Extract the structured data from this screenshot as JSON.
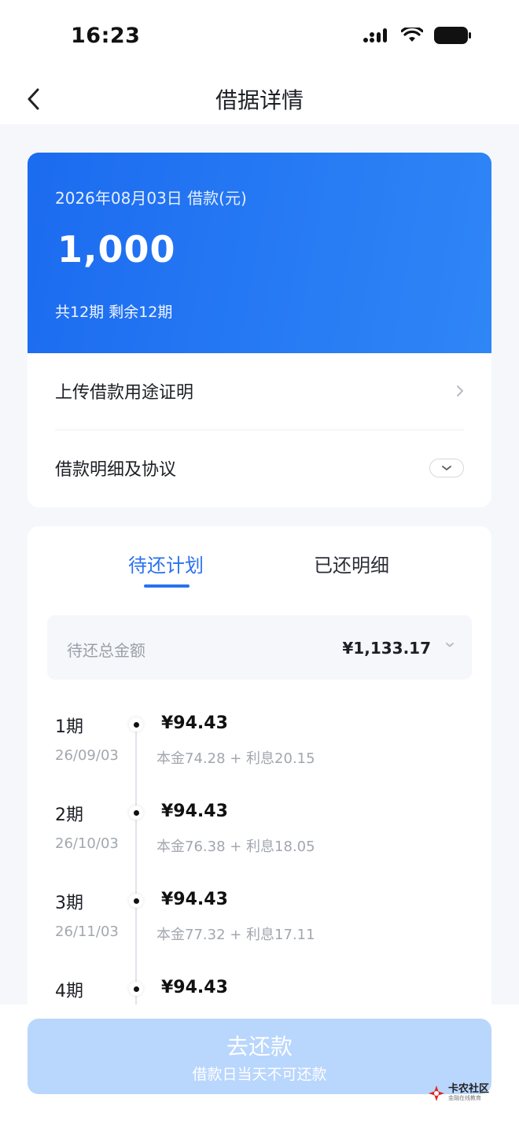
{
  "status_bar": {
    "time": "16:23"
  },
  "nav": {
    "title": "借据详情"
  },
  "loan": {
    "date_label": "2026年08月03日 借款(元)",
    "amount": "1,000",
    "terms": "共12期  剩余12期",
    "accent_color": "#1c6bf0"
  },
  "rows": {
    "upload_proof": "上传借款用途证明",
    "details_agreement": "借款明细及协议"
  },
  "tabs": {
    "pending_plan": "待还计划",
    "paid_details": "已还明细"
  },
  "total": {
    "label": "待还总金额",
    "amount": "¥1,133.17"
  },
  "installments": [
    {
      "period": "1期",
      "date": "26/09/03",
      "amount": "¥94.43",
      "breakdown": "本金74.28 + 利息20.15"
    },
    {
      "period": "2期",
      "date": "26/10/03",
      "amount": "¥94.43",
      "breakdown": "本金76.38 + 利息18.05"
    },
    {
      "period": "3期",
      "date": "26/11/03",
      "amount": "¥94.43",
      "breakdown": "本金77.32 + 利息17.11"
    },
    {
      "period": "4期",
      "date": "",
      "amount": "¥94.43",
      "breakdown": ""
    }
  ],
  "repay": {
    "label": "去还款",
    "sub": "借款日当天不可还款",
    "color": "#b9d6fd"
  },
  "watermark": {
    "main": "卡农社区",
    "sub": "金融在线教育"
  }
}
